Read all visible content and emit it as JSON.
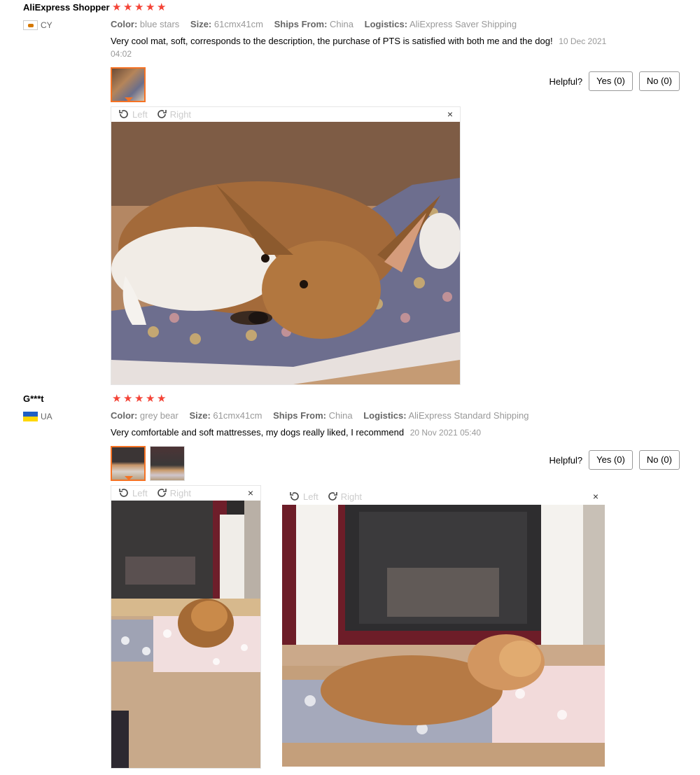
{
  "reviews": [
    {
      "user": "AliExpress Shopper",
      "country": "CY",
      "stars": 5,
      "attrs": [
        {
          "k": "Color:",
          "v": "blue stars"
        },
        {
          "k": "Size:",
          "v": "61cmx41cm"
        },
        {
          "k": "Ships From:",
          "v": "China"
        },
        {
          "k": "Logistics:",
          "v": "AliExpress Saver Shipping"
        }
      ],
      "text": "Very cool mat, soft, corresponds to the description, the purchase of PTS is satisfied with both me and the dog!",
      "date": "10 Dec 2021 04:02",
      "helpful_label": "Helpful?",
      "yes_label": "Yes (0)",
      "no_label": "No (0)",
      "viewer": {
        "left": "Left",
        "right": "Right",
        "close": "×"
      }
    },
    {
      "user": "G***t",
      "country": "UA",
      "stars": 5,
      "attrs": [
        {
          "k": "Color:",
          "v": "grey bear"
        },
        {
          "k": "Size:",
          "v": "61cmx41cm"
        },
        {
          "k": "Ships From:",
          "v": "China"
        },
        {
          "k": "Logistics:",
          "v": "AliExpress Standard Shipping"
        }
      ],
      "text": "Very comfortable and soft mattresses, my dogs really liked, I recommend",
      "date": "20 Nov 2021 05:40",
      "helpful_label": "Helpful?",
      "yes_label": "Yes (0)",
      "no_label": "No (0)",
      "viewer": {
        "left": "Left",
        "right": "Right",
        "close": "×"
      }
    }
  ],
  "icons": {
    "star": "star-icon",
    "rotate_left": "rotate-left-icon",
    "rotate_right": "rotate-right-icon",
    "close": "close-icon"
  },
  "colors": {
    "star": "#f44336",
    "accent": "#f57224"
  }
}
